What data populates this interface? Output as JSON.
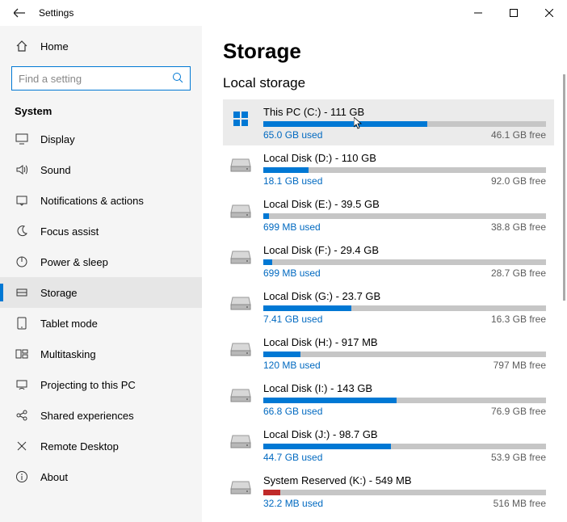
{
  "titlebar": {
    "title": "Settings"
  },
  "sidebar": {
    "home": "Home",
    "search_placeholder": "Find a setting",
    "group_label": "System",
    "items": [
      {
        "label": "Display",
        "icon": "display-icon"
      },
      {
        "label": "Sound",
        "icon": "sound-icon"
      },
      {
        "label": "Notifications & actions",
        "icon": "notifications-icon"
      },
      {
        "label": "Focus assist",
        "icon": "focus-icon"
      },
      {
        "label": "Power & sleep",
        "icon": "power-icon"
      },
      {
        "label": "Storage",
        "icon": "storage-icon",
        "selected": true
      },
      {
        "label": "Tablet mode",
        "icon": "tablet-icon"
      },
      {
        "label": "Multitasking",
        "icon": "multitasking-icon"
      },
      {
        "label": "Projecting to this PC",
        "icon": "projecting-icon"
      },
      {
        "label": "Shared experiences",
        "icon": "shared-icon"
      },
      {
        "label": "Remote Desktop",
        "icon": "remote-icon"
      },
      {
        "label": "About",
        "icon": "about-icon"
      }
    ]
  },
  "content": {
    "heading": "Storage",
    "subheading": "Local storage",
    "drives": [
      {
        "name": "This PC (C:) - 111 GB",
        "used": "65.0 GB used",
        "free": "46.1 GB free",
        "pct": 58,
        "icon": "os-drive",
        "selected": true
      },
      {
        "name": "Local Disk (D:) - 110 GB",
        "used": "18.1 GB used",
        "free": "92.0 GB free",
        "pct": 16,
        "icon": "hdd"
      },
      {
        "name": "Local Disk (E:) - 39.5 GB",
        "used": "699 MB used",
        "free": "38.8 GB free",
        "pct": 2,
        "icon": "hdd"
      },
      {
        "name": "Local Disk (F:) - 29.4 GB",
        "used": "699 MB used",
        "free": "28.7 GB free",
        "pct": 3,
        "icon": "hdd"
      },
      {
        "name": "Local Disk (G:) - 23.7 GB",
        "used": "7.41 GB used",
        "free": "16.3 GB free",
        "pct": 31,
        "icon": "hdd"
      },
      {
        "name": "Local Disk (H:) - 917 MB",
        "used": "120 MB used",
        "free": "797 MB free",
        "pct": 13,
        "icon": "hdd"
      },
      {
        "name": "Local Disk (I:) - 143 GB",
        "used": "66.8 GB used",
        "free": "76.9 GB free",
        "pct": 47,
        "icon": "hdd"
      },
      {
        "name": "Local Disk (J:) - 98.7 GB",
        "used": "44.7 GB used",
        "free": "53.9 GB free",
        "pct": 45,
        "icon": "hdd"
      },
      {
        "name": "System Reserved (K:) - 549 MB",
        "used": "32.2 MB used",
        "free": "516 MB free",
        "pct": 6,
        "icon": "hdd",
        "red": true
      }
    ]
  }
}
